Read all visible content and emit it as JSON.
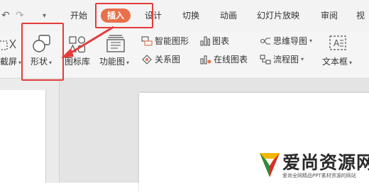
{
  "quick_access": {
    "undo_icon": "undo-icon",
    "redo_icon": "redo-icon",
    "dropdown_icon": "chevron-down-icon"
  },
  "tabs": [
    {
      "label": "开始"
    },
    {
      "label": "插入",
      "active": true
    },
    {
      "label": "设计"
    },
    {
      "label": "切换"
    },
    {
      "label": "动画"
    },
    {
      "label": "幻灯片放映"
    },
    {
      "label": "审阅"
    },
    {
      "label": "视"
    }
  ],
  "ribbon": {
    "screenshot_label": "截屏",
    "shape_label": "形状",
    "icon_library_label": "图标库",
    "function_chart_label": "功能图",
    "smart_shape_label": "智能图形",
    "chart_label": "图表",
    "mind_map_label": "思维导图",
    "relationship_label": "关系图",
    "online_chart_label": "在线图表",
    "flowchart_label": "流程图",
    "textbox_label": "文本框"
  },
  "watermark": {
    "title": "爱尚资源网",
    "subtitle": "爱尚全网精品PPT素材资源的网站"
  },
  "colors": {
    "accent": "#e8704a",
    "highlight": "#e53b3b",
    "toolbar_bg": "#f3f3f3",
    "workspace_bg": "#e4e4e4"
  }
}
